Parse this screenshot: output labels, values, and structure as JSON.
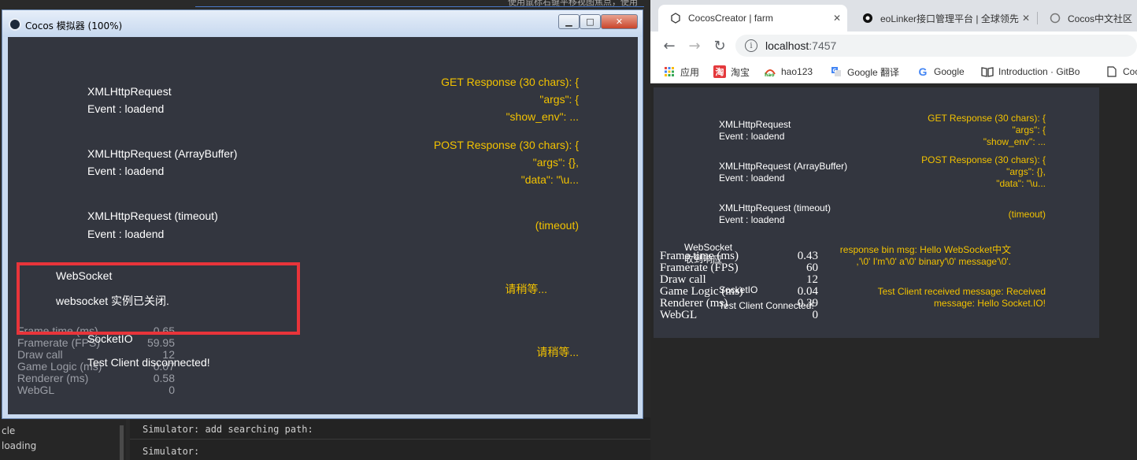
{
  "editor": {
    "hint_text": "使用鼠标右键平移视图焦点，使用",
    "left_panel_items": [
      "cle",
      "loading"
    ],
    "console_lines": [
      "Simulator: add searching path:",
      "Simulator:"
    ]
  },
  "simulator": {
    "title": "Cocos 模拟器 (100%)",
    "buttons": {
      "minimize": "▁",
      "maximize": "□",
      "close": "✕"
    },
    "rows": [
      {
        "title": "XMLHttpRequest",
        "event": "Event : loadend",
        "response": [
          "GET Response (30 chars): {",
          "\"args\": {",
          "\"show_env\": ..."
        ]
      },
      {
        "title": "XMLHttpRequest (ArrayBuffer)",
        "event": "Event : loadend",
        "response": [
          "POST Response (30 chars): {",
          "\"args\": {},",
          "\"data\": \"\\u..."
        ]
      },
      {
        "title": "XMLHttpRequest (timeout)",
        "event": "Event : loadend",
        "response": [
          "(timeout)"
        ]
      },
      {
        "title": "WebSocket",
        "event": "websocket 实例已关闭.",
        "response": [
          "请稍等..."
        ]
      },
      {
        "title": "SocketIO",
        "event": "Test Client disconnected!",
        "response": [
          "请稍等..."
        ]
      }
    ],
    "stats": [
      {
        "name": "Frame time (ms)",
        "value": "0.65"
      },
      {
        "name": "Framerate (FPS)",
        "value": "59.95"
      },
      {
        "name": "Draw call",
        "value": "12"
      },
      {
        "name": "Game Logic (ms)",
        "value": "0.07"
      },
      {
        "name": "Renderer (ms)",
        "value": "0.58"
      },
      {
        "name": "WebGL",
        "value": "0"
      }
    ],
    "highlight_color": "#e8343a"
  },
  "browser": {
    "tabs": [
      {
        "title": "CocosCreator | farm",
        "icon": "cocos-icon"
      },
      {
        "title": "eoLinker接口管理平台 | 全球领先",
        "icon": "eolinker-icon"
      },
      {
        "title": "Cocos中文社区",
        "icon": "chat-bubble-icon"
      }
    ],
    "url_host": "localhost",
    "url_port": ":7457",
    "bookmarks": [
      {
        "label": "应用",
        "icon": "apps-grid-icon"
      },
      {
        "label": "淘宝",
        "icon": "taobao-icon"
      },
      {
        "label": "hao123",
        "icon": "hao123-icon"
      },
      {
        "label": "Google 翻译",
        "icon": "google-translate-icon"
      },
      {
        "label": "Google",
        "icon": "google-icon"
      },
      {
        "label": "Introduction · GitBo",
        "icon": "book-icon"
      },
      {
        "label": "Coc",
        "icon": "doc-icon"
      }
    ],
    "game": {
      "rows": [
        {
          "title": "XMLHttpRequest",
          "event": "Event : loadend",
          "response": [
            "GET Response (30 chars): {",
            "\"args\": {",
            "\"show_env\": ..."
          ]
        },
        {
          "title": "XMLHttpRequest (ArrayBuffer)",
          "event": "Event : loadend",
          "response": [
            "POST Response (30 chars): {",
            "\"args\": {},",
            "\"data\": \"\\u..."
          ]
        },
        {
          "title": "XMLHttpRequest (timeout)",
          "event": "Event : loadend",
          "response": [
            "(timeout)"
          ]
        },
        {
          "title": "WebSocket",
          "event": "收到响应",
          "response": [
            "response bin msg: Hello WebSocket中文",
            ",'\\0' I'm'\\0' a'\\0' binary'\\0' message'\\0'."
          ]
        },
        {
          "title": "SocketIO",
          "event": "Test Client Connected!",
          "response": [
            "Test Client received message: Received",
            "message: Hello Socket.IO!"
          ]
        }
      ],
      "stats": [
        {
          "name": "Frame time (ms)",
          "value": "0.43"
        },
        {
          "name": "Framerate (FPS)",
          "value": "60"
        },
        {
          "name": "Draw call",
          "value": "12"
        },
        {
          "name": "Game Logic (ms)",
          "value": "0.04"
        },
        {
          "name": "Renderer (ms)",
          "value": "0.39"
        },
        {
          "name": "WebGL",
          "value": "0"
        }
      ]
    }
  },
  "colors": {
    "accent_yellow": "#f2c200",
    "canvas_bg": "#33363f"
  }
}
